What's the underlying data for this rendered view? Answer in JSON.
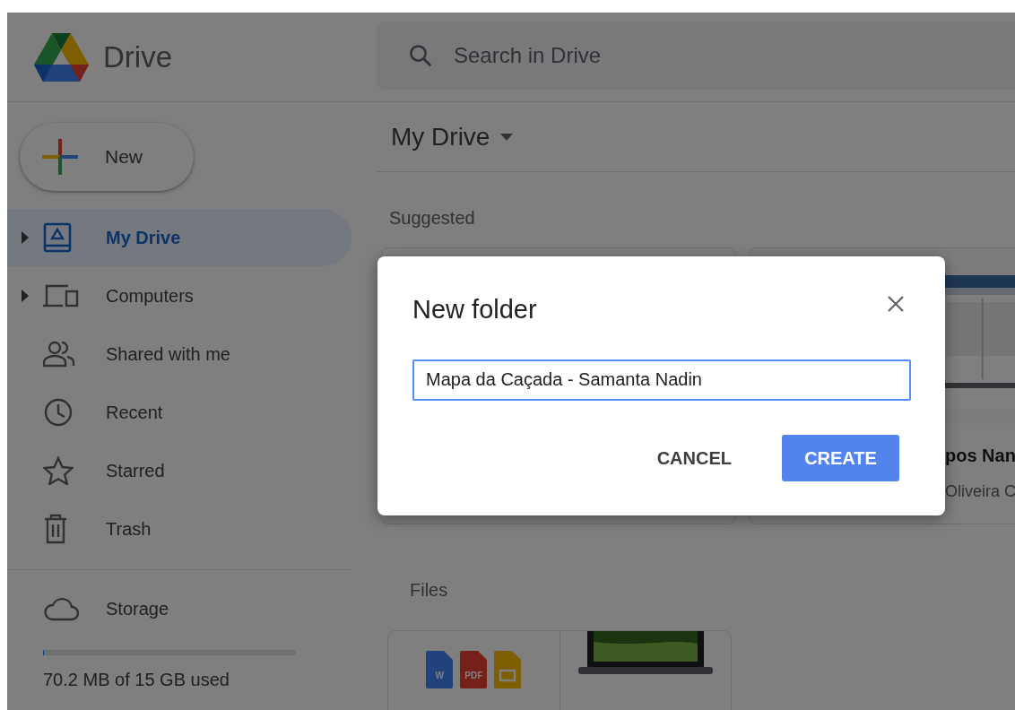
{
  "app": {
    "name": "Drive"
  },
  "search": {
    "placeholder": "Search in Drive"
  },
  "new_button": {
    "label": "New"
  },
  "sidebar": {
    "items": [
      {
        "label": "My Drive",
        "kind": "drive",
        "expander": true,
        "selected": true
      },
      {
        "label": "Computers",
        "kind": "computers",
        "expander": true,
        "selected": false
      },
      {
        "label": "Shared with me",
        "kind": "shared",
        "expander": false,
        "selected": false
      },
      {
        "label": "Recent",
        "kind": "recent",
        "expander": false,
        "selected": false
      },
      {
        "label": "Starred",
        "kind": "starred",
        "expander": false,
        "selected": false
      },
      {
        "label": "Trash",
        "kind": "trash",
        "expander": false,
        "selected": false
      }
    ]
  },
  "storage": {
    "label": "Storage",
    "level": 0.005,
    "usage": "70.2 MB of 15 GB used"
  },
  "main": {
    "title": "My Drive",
    "suggested": {
      "heading": "Suggested",
      "cards": [
        {
          "kind": "blank"
        },
        {
          "kind": "sheet",
          "title": "pos Nan",
          "subtitle": "Oliveira C"
        }
      ]
    },
    "files": {
      "heading": "Files",
      "cards": [
        {
          "kind": "docs",
          "icon_labels": [
            "W",
            "PDF"
          ]
        },
        {
          "kind": "laptop"
        }
      ]
    }
  },
  "dialog": {
    "title": "New folder",
    "value": "Mapa da Caçada - Samanta Nadin",
    "buttons": [
      {
        "label": "CANCEL",
        "kind": "text"
      },
      {
        "label": "CREATE",
        "kind": "primary"
      }
    ]
  }
}
